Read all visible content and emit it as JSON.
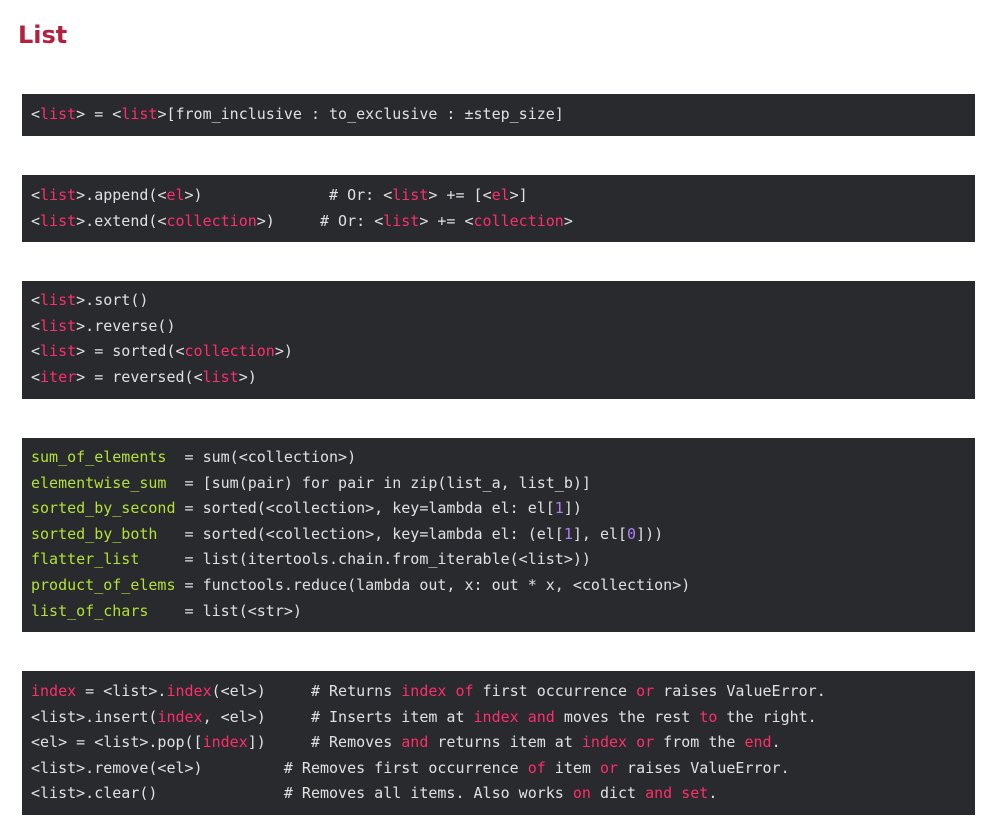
{
  "colors": {
    "title": "#b3213f",
    "code_bg": "#282a2e",
    "code_text": "#e0e0e0",
    "code_bracket": "#e0e0e0",
    "code_pink": "#ff2d6a",
    "code_green": "#b4e234",
    "code_purple": "#b07ef6"
  },
  "page": {
    "title": "List"
  },
  "code_blocks": [
    {
      "lines": [
        [
          [
            "<",
            "t"
          ],
          [
            "list",
            "p"
          ],
          [
            ">",
            "t"
          ],
          [
            " = ",
            "t"
          ],
          [
            "<",
            "t"
          ],
          [
            "list",
            "p"
          ],
          [
            ">",
            "t"
          ],
          [
            "[from_inclusive : to_exclusive : ±step_size]",
            "t"
          ]
        ]
      ]
    },
    {
      "lines": [
        [
          [
            "<",
            "t"
          ],
          [
            "list",
            "p"
          ],
          [
            ">.append(",
            "t"
          ],
          [
            "<",
            "t"
          ],
          [
            "el",
            "p"
          ],
          [
            ">)",
            "t"
          ],
          [
            "              # Or: ",
            "t"
          ],
          [
            "<",
            "t"
          ],
          [
            "list",
            "p"
          ],
          [
            "> += [",
            "t"
          ],
          [
            "<",
            "t"
          ],
          [
            "el",
            "p"
          ],
          [
            ">]",
            "t"
          ]
        ],
        [
          [
            "<",
            "t"
          ],
          [
            "list",
            "p"
          ],
          [
            ">.extend(",
            "t"
          ],
          [
            "<",
            "t"
          ],
          [
            "collection",
            "p"
          ],
          [
            ">)",
            "t"
          ],
          [
            "     # Or: ",
            "t"
          ],
          [
            "<",
            "t"
          ],
          [
            "list",
            "p"
          ],
          [
            "> += ",
            "t"
          ],
          [
            "<",
            "t"
          ],
          [
            "collection",
            "p"
          ],
          [
            ">",
            "t"
          ]
        ]
      ]
    },
    {
      "lines": [
        [
          [
            "<",
            "t"
          ],
          [
            "list",
            "p"
          ],
          [
            ">.sort()",
            "t"
          ]
        ],
        [
          [
            "<",
            "t"
          ],
          [
            "list",
            "p"
          ],
          [
            ">.reverse()",
            "t"
          ]
        ],
        [
          [
            "<",
            "t"
          ],
          [
            "list",
            "p"
          ],
          [
            "> = sorted(",
            "t"
          ],
          [
            "<",
            "t"
          ],
          [
            "collection",
            "p"
          ],
          [
            ">)",
            "t"
          ]
        ],
        [
          [
            "<",
            "t"
          ],
          [
            "iter",
            "p"
          ],
          [
            "> = reversed(",
            "t"
          ],
          [
            "<",
            "t"
          ],
          [
            "list",
            "p"
          ],
          [
            ">)",
            "t"
          ]
        ]
      ]
    },
    {
      "lines": [
        [
          [
            "sum_of_elements",
            "g"
          ],
          [
            "  = sum(<collection>)",
            "t"
          ]
        ],
        [
          [
            "elementwise_sum",
            "g"
          ],
          [
            "  = [sum(pair) for pair in zip(list_a, list_b)]",
            "t"
          ]
        ],
        [
          [
            "sorted_by_second",
            "g"
          ],
          [
            " = sorted(<collection>, key=lambda el: el[",
            "t"
          ],
          [
            "1",
            "v"
          ],
          [
            "])",
            "t"
          ]
        ],
        [
          [
            "sorted_by_both",
            "g"
          ],
          [
            "   = sorted(<collection>, key=lambda el: (el[",
            "t"
          ],
          [
            "1",
            "v"
          ],
          [
            "], el[",
            "t"
          ],
          [
            "0",
            "v"
          ],
          [
            "]))",
            "t"
          ]
        ],
        [
          [
            "flatter_list",
            "g"
          ],
          [
            "     = list(itertools.chain.from_iterable(<list>))",
            "t"
          ]
        ],
        [
          [
            "product_of_elems",
            "g"
          ],
          [
            " = functools.reduce(lambda out, x: out * x, <collection>)",
            "t"
          ]
        ],
        [
          [
            "list_of_chars",
            "g"
          ],
          [
            "    = list(<str>)",
            "t"
          ]
        ]
      ]
    },
    {
      "lines": [
        [
          [
            "index",
            "p"
          ],
          [
            " = <list>.",
            "t"
          ],
          [
            "index",
            "p"
          ],
          [
            "(<el>)",
            "t"
          ],
          [
            "     # Returns ",
            "t"
          ],
          [
            "index",
            "p"
          ],
          [
            " ",
            "t"
          ],
          [
            "of",
            "p"
          ],
          [
            " first occurrence ",
            "t"
          ],
          [
            "or",
            "p"
          ],
          [
            " raises ValueError.",
            "t"
          ]
        ],
        [
          [
            "<list>.insert(",
            "t"
          ],
          [
            "index",
            "p"
          ],
          [
            ", <el>)",
            "t"
          ],
          [
            "     # Inserts item at ",
            "t"
          ],
          [
            "index",
            "p"
          ],
          [
            " ",
            "t"
          ],
          [
            "and",
            "p"
          ],
          [
            " moves the rest ",
            "t"
          ],
          [
            "to",
            "p"
          ],
          [
            " the right.",
            "t"
          ]
        ],
        [
          [
            "<el> = <list>.pop([",
            "t"
          ],
          [
            "index",
            "p"
          ],
          [
            "])",
            "t"
          ],
          [
            "     # Removes ",
            "t"
          ],
          [
            "and",
            "p"
          ],
          [
            " returns item at ",
            "t"
          ],
          [
            "index",
            "p"
          ],
          [
            " ",
            "t"
          ],
          [
            "or",
            "p"
          ],
          [
            " from the ",
            "t"
          ],
          [
            "end",
            "p"
          ],
          [
            ".",
            "t"
          ]
        ],
        [
          [
            "<list>.remove(<el>)",
            "t"
          ],
          [
            "         # Removes first occurrence ",
            "t"
          ],
          [
            "of",
            "p"
          ],
          [
            " item ",
            "t"
          ],
          [
            "or",
            "p"
          ],
          [
            " raises ValueError.",
            "t"
          ]
        ],
        [
          [
            "<list>.clear()",
            "t"
          ],
          [
            "              # Removes all items. Also works ",
            "t"
          ],
          [
            "on",
            "p"
          ],
          [
            " dict ",
            "t"
          ],
          [
            "and",
            "p"
          ],
          [
            " ",
            "t"
          ],
          [
            "set",
            "p"
          ],
          [
            ".",
            "t"
          ]
        ]
      ]
    }
  ]
}
